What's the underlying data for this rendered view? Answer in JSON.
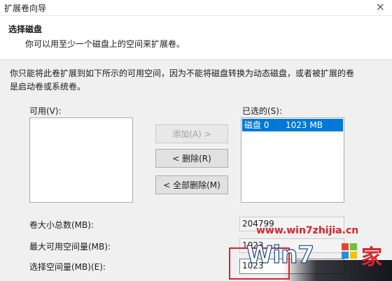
{
  "window": {
    "title": "扩展卷向导",
    "close_glyph": "×"
  },
  "header": {
    "title": "选择磁盘",
    "subtitle": "你可以用至少一个磁盘上的空间来扩展卷。"
  },
  "description_line1": "你只能将此卷扩展到如下所示的可用空间，因为不能将磁盘转换为动态磁盘，或者被扩展的卷",
  "description_line2": "是启动卷或系统卷。",
  "available": {
    "label": "可用(V):",
    "items": []
  },
  "selected": {
    "label": "已选的(S):",
    "items": [
      {
        "disk": "磁盘 0",
        "size": "1023 MB"
      }
    ]
  },
  "buttons": {
    "add": "添加(A) >",
    "remove": "< 删除(R)",
    "remove_all": "< 全部删除(M)"
  },
  "fields": {
    "total_label": "卷大小总数(MB):",
    "total_value": "204799",
    "max_label": "最大可用空间量(MB):",
    "max_value": "1023",
    "select_label": "选择空间量(MB)(E):",
    "select_value": "1023"
  },
  "watermark": {
    "url": "www.win7zhijia.cn",
    "logo_text": "Win7",
    "logo_suffix": "家"
  },
  "colors": {
    "selection": "#0078d7",
    "highlight_box": "#e0202a",
    "watermark_red": "#d8262c"
  }
}
